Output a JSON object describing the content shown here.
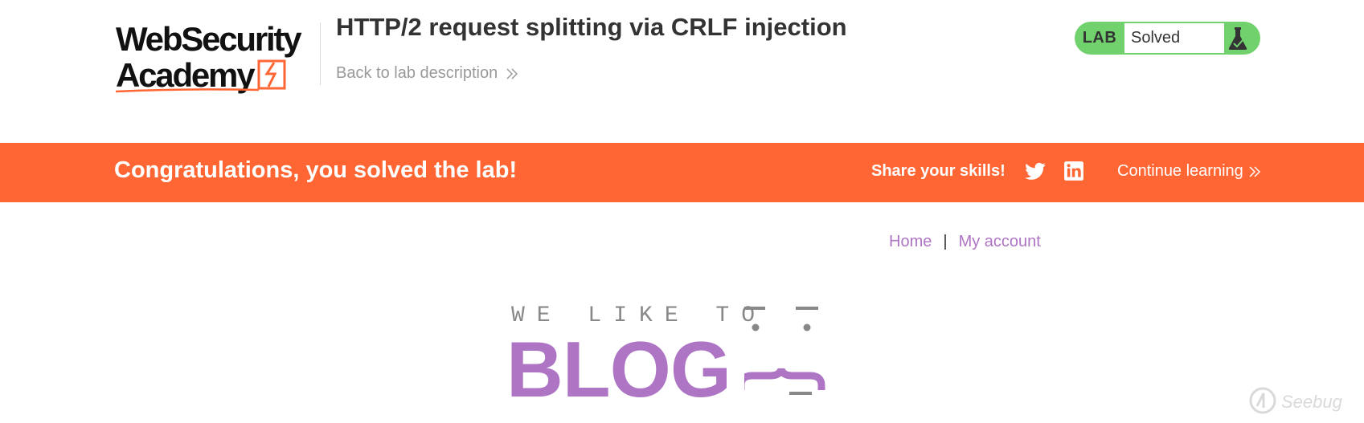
{
  "header": {
    "logo_text": "WebSecurity Academy",
    "lab_title": "HTTP/2 request splitting via CRLF injection",
    "back_link": "Back to lab description"
  },
  "status": {
    "lab_label": "LAB",
    "state": "Solved",
    "accent": "#70d16d"
  },
  "banner": {
    "message": "Congratulations, you solved the lab!",
    "share_label": "Share your skills!",
    "continue_label": "Continue learning",
    "background": "#ff6633",
    "icons": [
      "twitter-icon",
      "linkedin-icon"
    ]
  },
  "nav": {
    "home": "Home",
    "separator": "|",
    "my_account": "My account",
    "link_color": "#ae75c5"
  },
  "blog": {
    "tagline": "WE LIKE TO",
    "title": "BLOG"
  },
  "watermark": {
    "text": "Seebug"
  }
}
